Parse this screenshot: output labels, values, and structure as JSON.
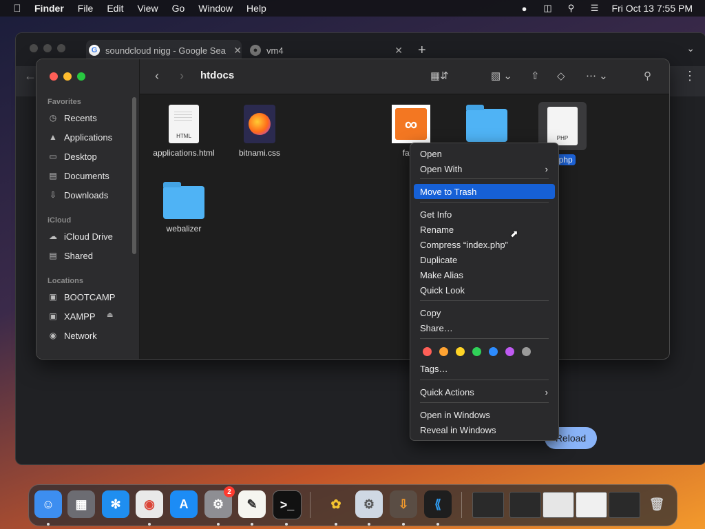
{
  "menubar": {
    "apple": "",
    "items": [
      "Finder",
      "File",
      "Edit",
      "View",
      "Go",
      "Window",
      "Help"
    ],
    "datetime": "Fri Oct 13  7:55 PM"
  },
  "browser": {
    "tabs": [
      {
        "title": "soundcloud nigg - Google Sea",
        "icon": "google-icon"
      },
      {
        "title": "vm4",
        "icon": "globe-icon"
      }
    ],
    "reload_label": "Reload"
  },
  "finder": {
    "title": "htdocs",
    "sidebar": {
      "favorites_header": "Favorites",
      "favorites": [
        "Recents",
        "Applications",
        "Desktop",
        "Documents",
        "Downloads"
      ],
      "icloud_header": "iCloud",
      "icloud": [
        "iCloud Drive",
        "Shared"
      ],
      "locations_header": "Locations",
      "locations": [
        "BOOTCAMP",
        "XAMPP",
        "Network"
      ]
    },
    "files": [
      {
        "name": "applications.html",
        "kind": "HTML"
      },
      {
        "name": "bitnami.css",
        "kind": "css"
      },
      {
        "name": "favic",
        "kind": "xampp"
      },
      {
        "name": "",
        "kind": "folder"
      },
      {
        "name": "x.php",
        "kind": "PHP"
      },
      {
        "name": "webalizer",
        "kind": "folder"
      }
    ]
  },
  "context_menu": {
    "items": [
      "Open",
      "Open With",
      "Move to Trash",
      "Get Info",
      "Rename",
      "Compress “index.php”",
      "Duplicate",
      "Make Alias",
      "Quick Look",
      "Copy",
      "Share…",
      "Tags…",
      "Quick Actions",
      "Open in Windows",
      "Reveal in Windows"
    ],
    "highlighted": "Move to Trash",
    "tag_colors": [
      "#ff5f57",
      "#ffa332",
      "#ffd426",
      "#30d158",
      "#2d8cff",
      "#bf5af2",
      "#9a9a9a"
    ]
  },
  "dock": {
    "settings_badge": "2"
  }
}
